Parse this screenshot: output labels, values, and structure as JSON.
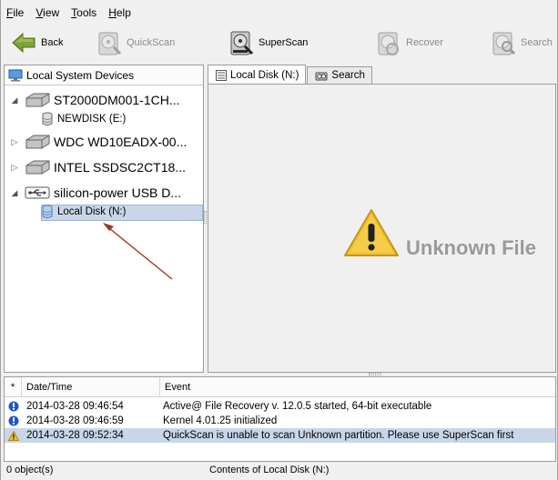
{
  "menu": [
    {
      "label_u": "F",
      "label_rest": "ile"
    },
    {
      "label_u": "V",
      "label_rest": "iew"
    },
    {
      "label_u": "T",
      "label_rest": "ools"
    },
    {
      "label_u": "H",
      "label_rest": "elp"
    }
  ],
  "toolbar": {
    "back": "Back",
    "quickscan": "QuickScan",
    "superscan": "SuperScan",
    "recover": "Recover",
    "search": "Search"
  },
  "left_panel": {
    "title": "Local System Devices",
    "devices": [
      {
        "label": "ST2000DM001-1CH..."
      },
      {
        "label": "NEWDISK (E:)"
      },
      {
        "label": "WDC WD10EADX-00..."
      },
      {
        "label": "INTEL SSDSC2CT18..."
      },
      {
        "label": "silicon-power USB D..."
      },
      {
        "label": "Local Disk (N:)"
      }
    ]
  },
  "tabs": [
    {
      "label": "Local Disk (N:)"
    },
    {
      "label": "Search"
    }
  ],
  "main": {
    "message": "Unknown File"
  },
  "log": {
    "headers": {
      "star": "*",
      "date": "Date/Time",
      "event": "Event"
    },
    "rows": [
      {
        "date": "2014-03-28 09:46:54",
        "event": "Active@ File Recovery v. 12.0.5 started, 64-bit executable"
      },
      {
        "date": "2014-03-28 09:46:59",
        "event": "Kernel 4.01.25 initialized"
      },
      {
        "date": "2014-03-28 09:52:34",
        "event": "QuickScan is unable to scan Unknown partition. Please use SuperScan first"
      }
    ]
  },
  "status": {
    "objects": "0 object(s)",
    "contents": "Contents of Local Disk (N:)"
  },
  "colors": {
    "selection": "#c9d6e8",
    "annotation_arrow": "#a0341c",
    "info_icon": "#1e56c8",
    "warning": "#f2c12e"
  }
}
